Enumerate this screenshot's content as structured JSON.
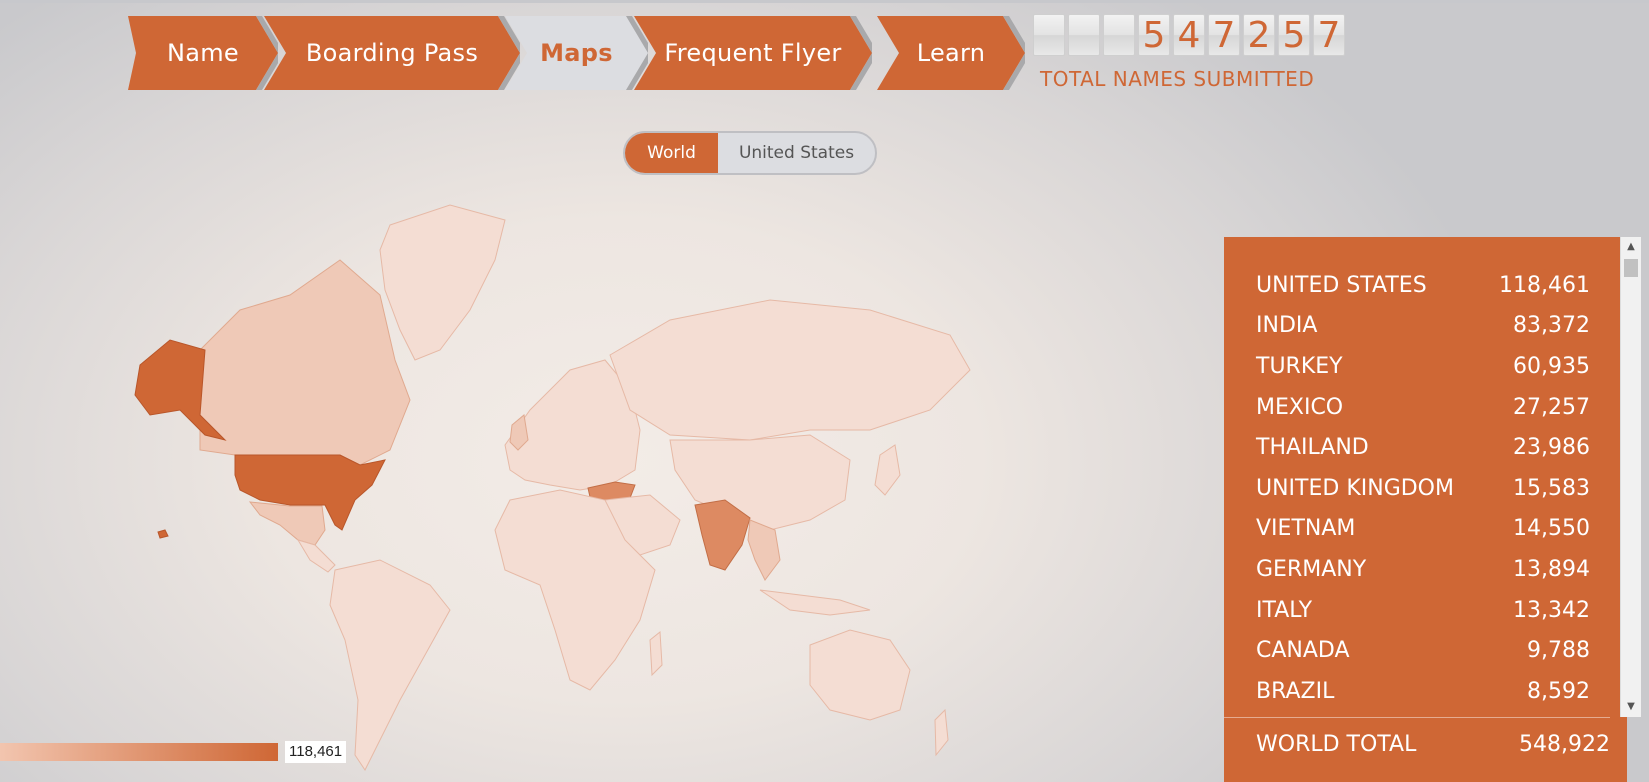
{
  "nav": {
    "tabs": [
      {
        "label": "Name"
      },
      {
        "label": "Boarding Pass"
      },
      {
        "label": "Maps"
      },
      {
        "label": "Frequent Flyer"
      },
      {
        "label": "Learn"
      }
    ],
    "active": "Maps"
  },
  "counter": {
    "digits": [
      "",
      "",
      "",
      "5",
      "4",
      "7",
      "2",
      "5",
      "7"
    ],
    "label": "TOTAL NAMES SUBMITTED"
  },
  "toggle": {
    "world": "World",
    "us": "United States",
    "selected": "World"
  },
  "legend": {
    "max": "118,461",
    "color_low": "#f2c5af",
    "color_high": "#cf6735"
  },
  "countries": [
    {
      "name": "UNITED STATES",
      "count": "118,461"
    },
    {
      "name": "INDIA",
      "count": "83,372"
    },
    {
      "name": "TURKEY",
      "count": "60,935"
    },
    {
      "name": "MEXICO",
      "count": "27,257"
    },
    {
      "name": "THAILAND",
      "count": "23,986"
    },
    {
      "name": "UNITED KINGDOM",
      "count": "15,583"
    },
    {
      "name": "VIETNAM",
      "count": "14,550"
    },
    {
      "name": "GERMANY",
      "count": "13,894"
    },
    {
      "name": "ITALY",
      "count": "13,342"
    },
    {
      "name": "CANADA",
      "count": "9,788"
    },
    {
      "name": "BRAZIL",
      "count": "8,592"
    }
  ],
  "total": {
    "label": "WORLD TOTAL",
    "value": "548,922"
  },
  "colors": {
    "accent": "#cf6735",
    "inactive_tab": "#dcdde1"
  }
}
